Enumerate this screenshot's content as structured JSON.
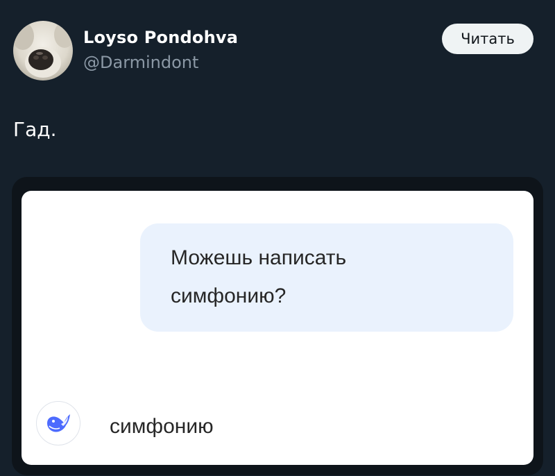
{
  "author": {
    "display_name": "Loyso Pondohva",
    "handle": "@Darmindont",
    "avatar_icon": "dog-avatar-icon"
  },
  "follow_button": {
    "label": "Читать"
  },
  "tweet": {
    "text": "Гад."
  },
  "chat": {
    "user_message_line1": "Можешь написать",
    "user_message_line2": "симфонию?",
    "bot_avatar_icon": "whale-icon",
    "bot_reply": "симфонию"
  },
  "colors": {
    "background": "#15202b",
    "handle_gray": "#8b98a5",
    "bubble_bg": "#eaf2fd",
    "whale_blue": "#4d6bfe"
  }
}
